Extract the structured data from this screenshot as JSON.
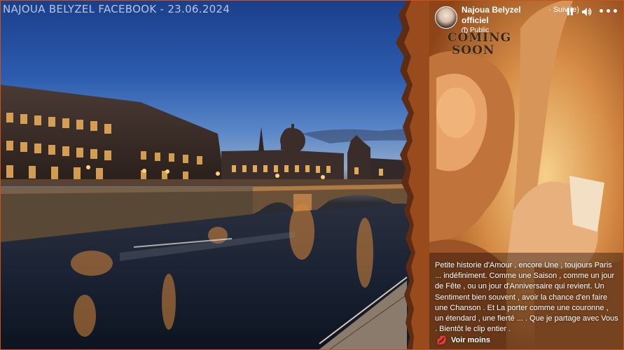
{
  "watermark": "NAJOUA BELYZEL FACEBOOK - 23.06.2024",
  "story": {
    "author": "Najoua Belyzel officiel",
    "follow_label": "· Suivi(e)",
    "privacy_label": "Public",
    "icons": {
      "pause": "pause-icon",
      "volume": "volume-icon",
      "more": "more-icon",
      "globe": "globe-icon",
      "lips": "lips-icon"
    },
    "artwork_text_line1": "COMING",
    "artwork_text_line2": "SOON",
    "caption": "Petite historie d'Amour , encore Une , toujours Paris ... indéfiniment. Comme une Saison , comme un jour de Fête , ou un jour d'Anniversaire qui revient. Un Sentiment bien souvent , avoir la chance d'en faire une Chanson . Et La porter comme une couronne , un étendard , une fierté ... . Que je partage avec Vous . Bientôt le clip entier .",
    "see_less": "Voir moins",
    "more_glyph": "•••",
    "lips_glyph": "💋"
  },
  "colors": {
    "frame_border": "#c9541b",
    "watermark": "#c8d3ea",
    "story_warm": "#b56a2d"
  }
}
